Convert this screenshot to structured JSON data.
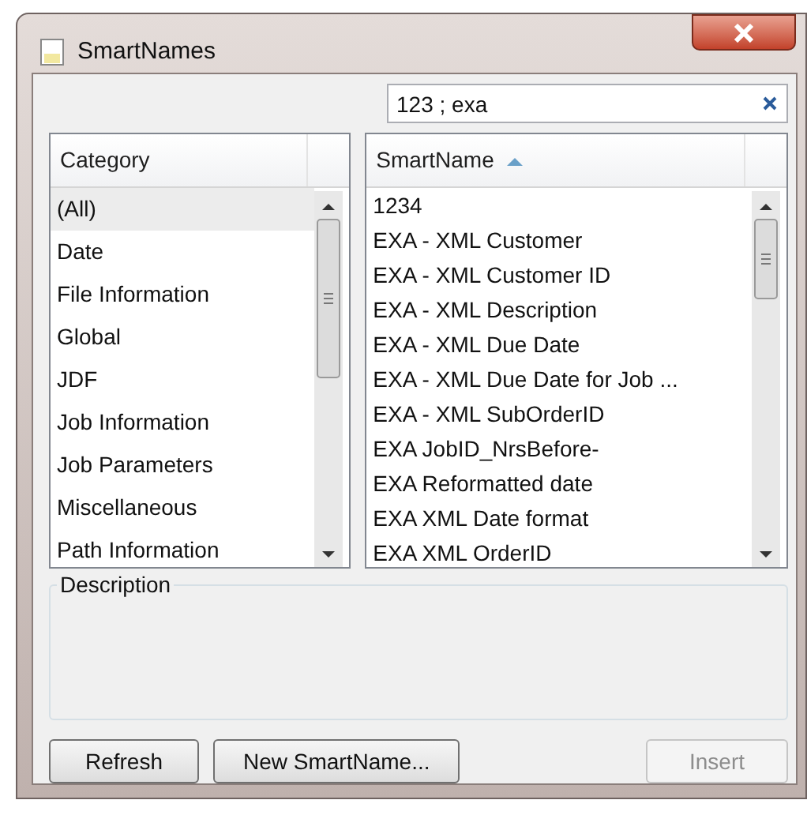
{
  "window": {
    "title": "SmartNames"
  },
  "search": {
    "value": "123 ; exa"
  },
  "category_list": {
    "header": "Category",
    "items": [
      {
        "label": "(All)",
        "selected": true
      },
      {
        "label": "Date",
        "selected": false
      },
      {
        "label": "File Information",
        "selected": false
      },
      {
        "label": "Global",
        "selected": false
      },
      {
        "label": "JDF",
        "selected": false
      },
      {
        "label": "Job Information",
        "selected": false
      },
      {
        "label": "Job Parameters",
        "selected": false
      },
      {
        "label": "Miscellaneous",
        "selected": false
      },
      {
        "label": "Path Information",
        "selected": false
      }
    ]
  },
  "smartname_list": {
    "header": "SmartName",
    "items": [
      {
        "label": "1234",
        "selected": false
      },
      {
        "label": "EXA - XML Customer",
        "selected": false
      },
      {
        "label": "EXA - XML Customer ID",
        "selected": false
      },
      {
        "label": "EXA - XML Description",
        "selected": false
      },
      {
        "label": "EXA - XML Due Date",
        "selected": false
      },
      {
        "label": "EXA - XML Due Date for Job ...",
        "selected": false
      },
      {
        "label": "EXA - XML SubOrderID",
        "selected": false
      },
      {
        "label": "EXA JobID_NrsBefore-",
        "selected": false
      },
      {
        "label": "EXA Reformatted date",
        "selected": false
      },
      {
        "label": "EXA XML Date format",
        "selected": false
      },
      {
        "label": "EXA XML OrderID",
        "selected": false
      }
    ]
  },
  "description": {
    "label": "Description"
  },
  "buttons": [
    {
      "label": "Refresh",
      "disabled": false
    },
    {
      "label": "New SmartName...",
      "disabled": false
    },
    {
      "label": "Insert",
      "disabled": true
    }
  ]
}
